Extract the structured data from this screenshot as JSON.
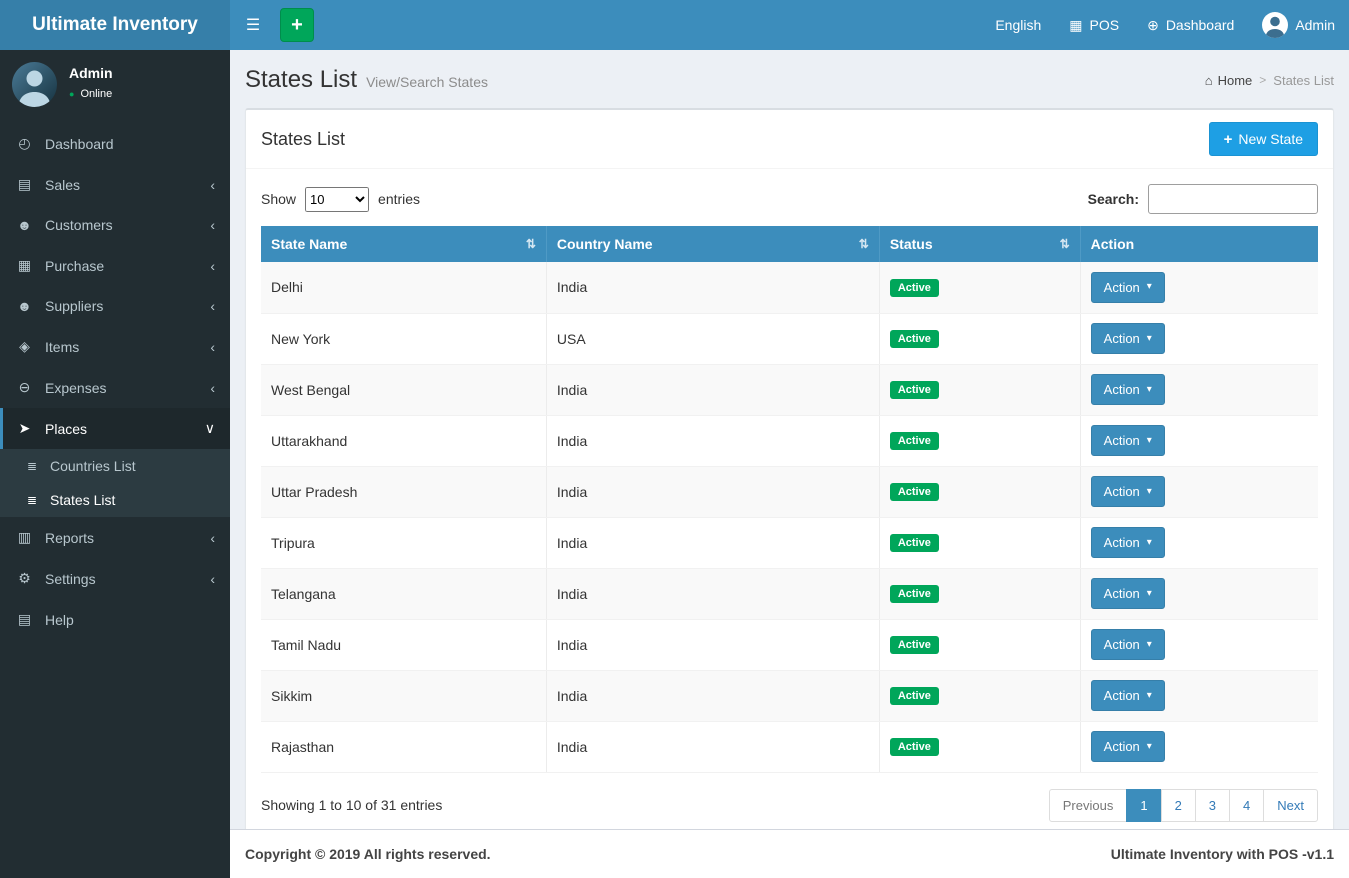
{
  "colors": {
    "brand_blue": "#3c8dbc",
    "logo_blue": "#367fa9",
    "sidebar_dark": "#222d32",
    "submenu_dark": "#2c3b41",
    "success_green": "#00a65a",
    "new_state_blue": "#1e9fe4",
    "body_bg": "#ecf0f5"
  },
  "icons": {
    "hamburger": "☰",
    "plus": "+",
    "calculator": "▦",
    "globe": "⊕",
    "home": "⌂",
    "chevron-left": "‹",
    "chevron-down": "∨",
    "caret-down": "▾",
    "sort": "⇅",
    "online-dot": "●",
    "dashboard": "◴",
    "sales": "▤",
    "customers": "☻",
    "purchase": "▦",
    "suppliers": "☻",
    "items": "◈",
    "expenses": "⊖",
    "places": "➤",
    "reports": "▥",
    "settings": "⚙",
    "help": "▤",
    "list": "≣"
  },
  "app": {
    "title": "Ultimate Inventory"
  },
  "topbar": {
    "add_label": "+",
    "english": "English",
    "pos": "POS",
    "dashboard": "Dashboard",
    "user": "Admin"
  },
  "sidebar": {
    "user": {
      "name": "Admin",
      "status": "Online"
    },
    "items": [
      {
        "label": "Dashboard"
      },
      {
        "label": "Sales"
      },
      {
        "label": "Customers"
      },
      {
        "label": "Purchase"
      },
      {
        "label": "Suppliers"
      },
      {
        "label": "Items"
      },
      {
        "label": "Expenses"
      },
      {
        "label": "Places"
      },
      {
        "label": "Reports"
      },
      {
        "label": "Settings"
      },
      {
        "label": "Help"
      }
    ],
    "places_submenu": [
      {
        "label": "Countries List"
      },
      {
        "label": "States List"
      }
    ]
  },
  "page": {
    "title": "States List",
    "subtitle": "View/Search States",
    "breadcrumb": {
      "home": "Home",
      "separator": ">",
      "current": "States List"
    },
    "box": {
      "title": "States List",
      "new_button": "New State"
    },
    "controls": {
      "show_label": "Show",
      "page_length": "10",
      "entries_label": "entries",
      "search_label": "Search:",
      "search_value": ""
    },
    "table": {
      "headers": [
        "State Name",
        "Country Name",
        "Status",
        "Action"
      ],
      "action_button": "Action",
      "rows": [
        {
          "state": "Delhi",
          "country": "India",
          "status": "Active"
        },
        {
          "state": "New York",
          "country": "USA",
          "status": "Active"
        },
        {
          "state": "West Bengal",
          "country": "India",
          "status": "Active"
        },
        {
          "state": "Uttarakhand",
          "country": "India",
          "status": "Active"
        },
        {
          "state": "Uttar Pradesh",
          "country": "India",
          "status": "Active"
        },
        {
          "state": "Tripura",
          "country": "India",
          "status": "Active"
        },
        {
          "state": "Telangana",
          "country": "India",
          "status": "Active"
        },
        {
          "state": "Tamil Nadu",
          "country": "India",
          "status": "Active"
        },
        {
          "state": "Sikkim",
          "country": "India",
          "status": "Active"
        },
        {
          "state": "Rajasthan",
          "country": "India",
          "status": "Active"
        }
      ]
    },
    "summary": "Showing 1 to 10 of 31 entries",
    "pagination": {
      "previous": "Previous",
      "pages": [
        "1",
        "2",
        "3",
        "4"
      ],
      "active_page": "1",
      "next": "Next"
    }
  },
  "footer": {
    "left": "Copyright © 2019 All rights reserved.",
    "right": "Ultimate Inventory with POS -v1.1"
  }
}
